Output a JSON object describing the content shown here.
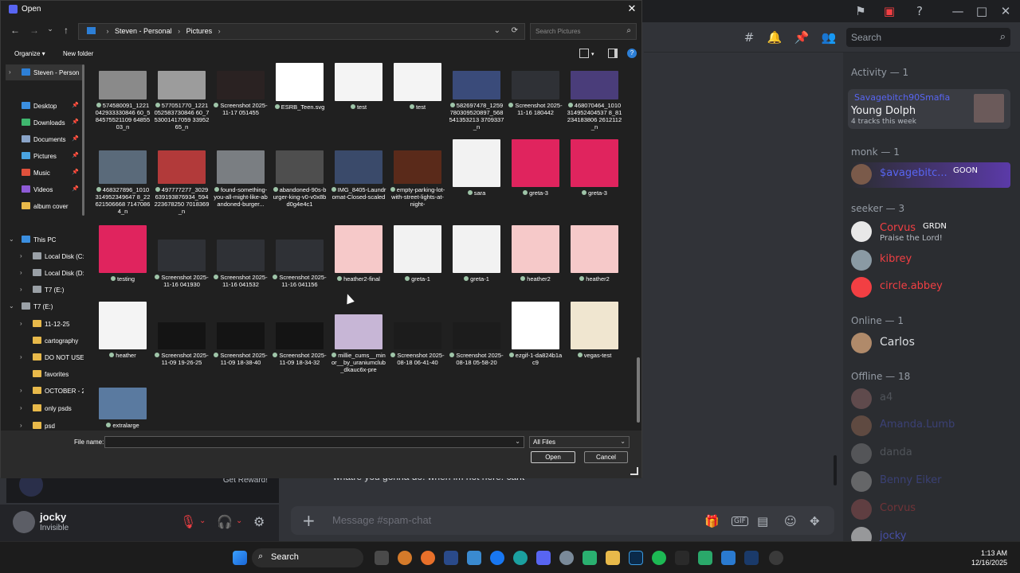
{
  "dialog": {
    "title": "Open",
    "close": "✕",
    "breadcrumb": [
      "Steven - Personal",
      "Pictures"
    ],
    "search_placeholder": "Search Pictures",
    "organize": "Organize ▾",
    "new_folder": "New folder",
    "file_name_label": "File name:",
    "file_name_value": "",
    "file_type": "All Files",
    "open_button": "Open",
    "cancel_button": "Cancel"
  },
  "nav_pane": [
    {
      "label": "Steven - Person",
      "icon": "cloud-icon",
      "arrow": "›",
      "selected": true,
      "color": "#2d7fd6"
    },
    {
      "label": "Desktop",
      "icon": "desktop-icon",
      "pin": true,
      "color": "#3b8fe0"
    },
    {
      "label": "Downloads",
      "icon": "download-icon",
      "pin": true,
      "color": "#3fb76e"
    },
    {
      "label": "Documents",
      "icon": "document-icon",
      "pin": true,
      "color": "#8aa4c8"
    },
    {
      "label": "Pictures",
      "icon": "pictures-icon",
      "pin": true,
      "color": "#4aa3df"
    },
    {
      "label": "Music",
      "icon": "music-icon",
      "pin": true,
      "color": "#e0513c"
    },
    {
      "label": "Videos",
      "icon": "videos-icon",
      "pin": true,
      "color": "#8e5bd6"
    },
    {
      "label": "album cover",
      "icon": "folder-icon",
      "color": "#e8b94a"
    },
    {
      "label": "This PC",
      "icon": "pc-icon",
      "arrow": "⌄",
      "color": "#3b8fe0"
    },
    {
      "label": "Local Disk (C:)",
      "icon": "disk-icon",
      "arrow": "›",
      "color": "#9aa0a6"
    },
    {
      "label": "Local Disk (D:)",
      "icon": "disk-icon",
      "arrow": "›",
      "color": "#9aa0a6"
    },
    {
      "label": "T7 (E:)",
      "icon": "disk-icon",
      "arrow": "›",
      "color": "#9aa0a6"
    },
    {
      "label": "T7 (E:)",
      "icon": "disk-icon",
      "arrow": "⌄",
      "color": "#9aa0a6"
    },
    {
      "label": "11-12-25",
      "icon": "folder-icon",
      "arrow": "›",
      "color": "#e8b94a"
    },
    {
      "label": "cartography",
      "icon": "folder-icon",
      "color": "#e8b94a"
    },
    {
      "label": "DO NOT USE",
      "icon": "folder-icon",
      "arrow": "›",
      "color": "#e8b94a"
    },
    {
      "label": "favorites",
      "icon": "folder-icon",
      "color": "#e8b94a"
    },
    {
      "label": "OCTOBER - 20",
      "icon": "folder-icon",
      "arrow": "›",
      "color": "#e8b94a"
    },
    {
      "label": "only psds",
      "icon": "folder-icon",
      "arrow": "›",
      "color": "#e8b94a"
    },
    {
      "label": "psd",
      "icon": "folder-icon",
      "arrow": "›",
      "color": "#e8b94a"
    }
  ],
  "files": [
    {
      "name": "574580091_1221042933330846 60_584575521109 6485503_n",
      "thumb": "#8a8a8a"
    },
    {
      "name": "577051770_1221052583730846 60_753001417059 3395265_n",
      "thumb": "#9c9c9c"
    },
    {
      "name": "Screenshot 2025-11-17 051455",
      "thumb": "#2a2222"
    },
    {
      "name": "ESRB_Teen.svg",
      "thumb": "#ffffff"
    },
    {
      "name": "test",
      "thumb": "#f4f4f4"
    },
    {
      "name": "test",
      "thumb": "#f4f4f4"
    },
    {
      "name": "582697478_1259780309520897_568541353213 3709337_n",
      "thumb": "#3a4b7a"
    },
    {
      "name": "Screenshot 2025-11-16 180442",
      "thumb": "#2f3136"
    },
    {
      "name": "468070464_1010314952404537 8_81234183806 2612112_n",
      "thumb": "#4a3d7a"
    },
    {
      "name": "468327896_1010314952349647 8_22621506668 71470864_n",
      "thumb": "#5a6a7a"
    },
    {
      "name": "497777277_3029639193876934_594223678250 7018369_n",
      "thumb": "#b23a3a"
    },
    {
      "name": "found-something-you-all-might-like-abandoned-burger...",
      "thumb": "#7a7e82"
    },
    {
      "name": "abandoned-90s-burger-king-v0-v0x8bd0g4e4c1",
      "thumb": "#4e4e4e"
    },
    {
      "name": "IMG_8405-Laundromat-Closed-scaled",
      "thumb": "#3a4a6a"
    },
    {
      "name": "empty-parking-lot-with-street-lights-at-night-",
      "thumb": "#5a2a1a"
    },
    {
      "name": "sara",
      "thumb": "#f2f2f2"
    },
    {
      "name": "greta-3",
      "thumb": "#e0245e"
    },
    {
      "name": "greta-3",
      "thumb": "#e0245e"
    },
    {
      "name": "testing",
      "thumb": "#e0245e"
    },
    {
      "name": "Screenshot 2025-11-16 041930",
      "thumb": "#2f3136"
    },
    {
      "name": "Screenshot 2025-11-16 041532",
      "thumb": "#2f3136"
    },
    {
      "name": "Screenshot 2025-11-16 041156",
      "thumb": "#2f3136"
    },
    {
      "name": "heather2-final",
      "thumb": "#f6c9c9"
    },
    {
      "name": "greta-1",
      "thumb": "#f2f2f2"
    },
    {
      "name": "greta-1",
      "thumb": "#f2f2f2"
    },
    {
      "name": "heather2",
      "thumb": "#f6c9c9"
    },
    {
      "name": "heather2",
      "thumb": "#f6c9c9"
    },
    {
      "name": "heather",
      "thumb": "#f4f4f4"
    },
    {
      "name": "Screenshot 2025-11-09 19-26-25",
      "thumb": "#141414"
    },
    {
      "name": "Screenshot 2025-11-09 18-38-40",
      "thumb": "#141414"
    },
    {
      "name": "Screenshot 2025-11-09 18-34-32",
      "thumb": "#141414"
    },
    {
      "name": "millie_cums__minor__by_uraniumclub_dkauc6x-pre",
      "thumb": "#c7b6d6"
    },
    {
      "name": "Screenshot 2025-08-18 06-41-40",
      "thumb": "#1c1c1c"
    },
    {
      "name": "Screenshot 2025-08-18 05-58-20",
      "thumb": "#1c1c1c"
    },
    {
      "name": "ezgif-1-da824b1ac9",
      "thumb": "#ffffff"
    },
    {
      "name": "vegas-test",
      "thumb": "#f0e6d0"
    },
    {
      "name": "extralarge",
      "thumb": "#5a7aa0"
    }
  ],
  "discord": {
    "search_placeholder": "Search",
    "activity_header": "Activity — 1",
    "activity_card": {
      "title": "Savagebitch90Smafia",
      "name": "Young Dolph",
      "sub": "4 tracks this week"
    },
    "sections": [
      {
        "label": "monk — 1",
        "members": [
          {
            "name": "$avagebitc...",
            "badge": "GOON",
            "color": "#5865f2"
          }
        ]
      },
      {
        "label": "seeker — 3",
        "members": [
          {
            "name": "Corvus",
            "badge": "GRDN",
            "sub": "Praise the Lord!",
            "color": "#f23f43"
          },
          {
            "name": "kibrey",
            "color": "#f23f43"
          },
          {
            "name": "circle.abbey",
            "color": "#f23f43"
          }
        ]
      },
      {
        "label": "Online — 1",
        "members": [
          {
            "name": "Carlos",
            "color": "#dbdee1"
          }
        ]
      },
      {
        "label": "Offline — 18",
        "members": [
          {
            "name": "a4",
            "color": "#949ba4"
          },
          {
            "name": "Amanda.Lumb",
            "color": "#5865f2"
          },
          {
            "name": "danda",
            "color": "#949ba4"
          },
          {
            "name": "Benny Eiker",
            "color": "#5865f2"
          },
          {
            "name": "Corvus",
            "color": "#f23f43"
          },
          {
            "name": "jocky",
            "color": "#5865f2"
          }
        ]
      }
    ],
    "chat_placeholder": "Message #spam-chat",
    "chat_preview": "whatre you gonna do. when im not here. cant",
    "user": {
      "name": "jocky",
      "status": "Invisible"
    },
    "promo_button": "Get Reward!"
  },
  "taskbar": {
    "search": "Search",
    "time": "1:13 AM",
    "date": "12/16/2025"
  }
}
